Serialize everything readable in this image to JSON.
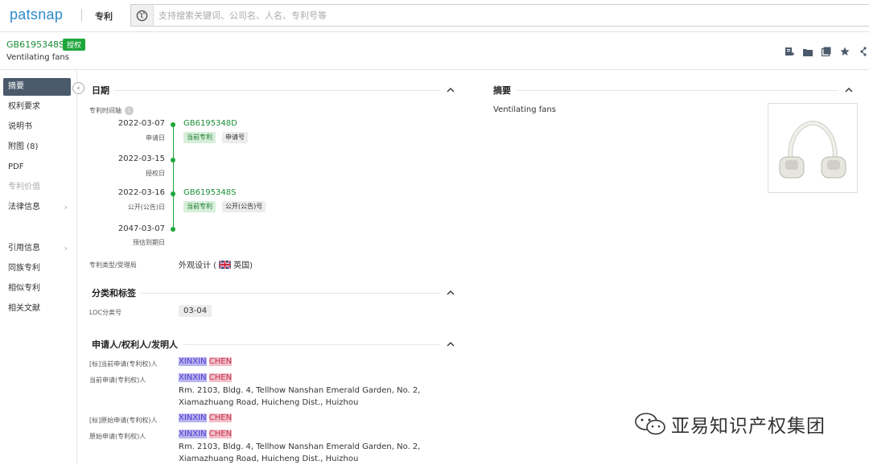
{
  "topbar": {
    "logo": "patsnap",
    "module": "专利",
    "search_placeholder": "支持搜索关键词、公司名、人名、专利号等"
  },
  "header": {
    "patent_number": "GB6195348S",
    "status_badge": "授权",
    "title": "Ventilating fans"
  },
  "sidebar": {
    "items": [
      {
        "label": "摘要",
        "state": "active"
      },
      {
        "label": "权利要求"
      },
      {
        "label": "说明书"
      },
      {
        "label": "附图 (8)"
      },
      {
        "label": "PDF"
      },
      {
        "label": "专利价值",
        "state": "disabled"
      },
      {
        "label": "法律信息",
        "chevron": true
      },
      {
        "label": "引用信息",
        "chevron": true
      },
      {
        "label": "同族专利"
      },
      {
        "label": "相似专利"
      },
      {
        "label": "相关文献"
      }
    ]
  },
  "dates_section": {
    "title": "日期",
    "timeline_label": "专利时间轴",
    "events": [
      {
        "date": "2022-03-07",
        "label": "申请日",
        "link": "GB6195348D",
        "tags": [
          "当前专利",
          "申请号"
        ]
      },
      {
        "date": "2022-03-15",
        "label": "授权日"
      },
      {
        "date": "2022-03-16",
        "label": "公开(公告)日",
        "link": "GB6195348S",
        "tags": [
          "当前专利",
          "公开(公告)号"
        ]
      },
      {
        "date": "2047-03-07",
        "label": "预估到期日"
      }
    ],
    "type_label": "专利类型/受理局",
    "type_value": "外观设计 (",
    "type_country": "英国)"
  },
  "classification_section": {
    "title": "分类和标签",
    "loc_label": "LOC分类号",
    "loc_value": "03-04"
  },
  "applicant_section": {
    "title": "申请人/权利人/发明人",
    "rows": [
      {
        "label": "[标]当前申请(专利权)人",
        "first": "XINXIN",
        "last": "CHEN"
      },
      {
        "label": "当前申请(专利权)人",
        "first": "XINXIN",
        "last": "CHEN",
        "address": "Rm. 2103, Bldg. 4, Tellhow Nanshan Emerald Garden, No. 2, Xiamazhuang Road, Huicheng Dist., Huizhou"
      },
      {
        "label": "[标]原始申请(专利权)人",
        "first": "XINXIN",
        "last": "CHEN"
      },
      {
        "label": "原始申请(专利权)人",
        "first": "XINXIN",
        "last": "CHEN",
        "address": "Rm. 2103, Bldg. 4, Tellhow Nanshan Emerald Garden, No. 2, Xiamazhuang Road, Huicheng Dist., Huizhou"
      }
    ]
  },
  "abstract_section": {
    "title": "摘要",
    "text": "Ventilating fans"
  },
  "watermark": {
    "text": "亚易知识产权集团"
  },
  "colors": {
    "brand": "#2c8bc9",
    "green": "#1ea63a",
    "sidebar_active": "#4b5a6b"
  }
}
